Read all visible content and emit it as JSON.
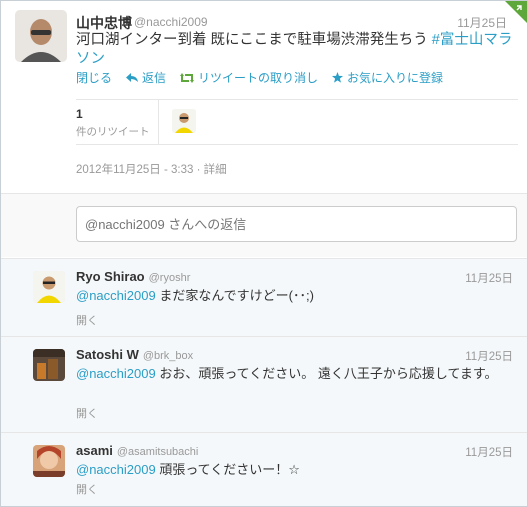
{
  "main_tweet": {
    "name": "山中忠博",
    "handle": "@nacchi2009",
    "time": "11月25日",
    "text": "河口湖インター到着 既にここまで駐車場渋滞発生ちう ",
    "hashtag": "#富士山マラソン",
    "actions": {
      "close": "閉じる",
      "reply": "返信",
      "unretweet": "リツイートの取り消し",
      "favorite": "お気に入りに登録"
    },
    "retweet_count": "1",
    "retweet_label": "件のリツイート",
    "timestamp": "2012年11月25日 - 3:33",
    "details": "詳細"
  },
  "reply_box": {
    "placeholder": "@nacchi2009 さんへの返信"
  },
  "replies": [
    {
      "name": "Ryo Shirao",
      "handle": "@ryoshr",
      "time": "11月25日",
      "mention": "@nacchi2009",
      "text": " まだ家なんですけどー(･･;)",
      "open": "開く"
    },
    {
      "name": "Satoshi W",
      "handle": "@brk_box",
      "time": "11月25日",
      "mention": "@nacchi2009",
      "text": " おお、頑張ってください。 遠く八王子から応援してます。",
      "open": "開く"
    },
    {
      "name": "asami",
      "handle": "@asamitsubachi",
      "time": "11月25日",
      "mention": "@nacchi2009",
      "text": " 頑張ってくださいー！☆",
      "open": "開く"
    }
  ],
  "colors": {
    "link": "#2b9ec6",
    "retweet_corner": "#5ea73b"
  }
}
